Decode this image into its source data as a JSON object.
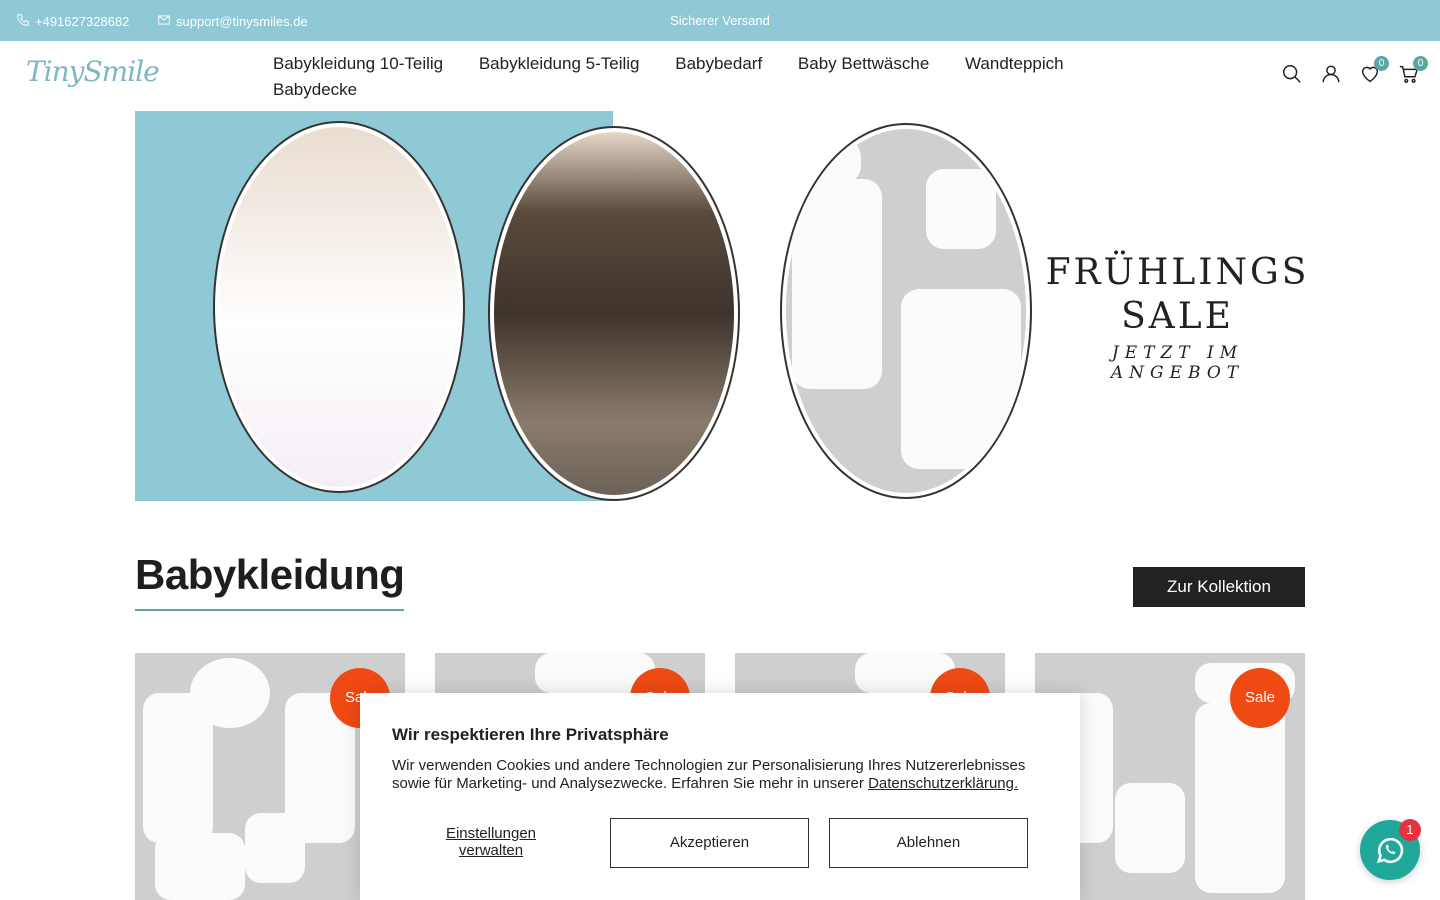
{
  "topbar": {
    "phone": "+491627328682",
    "email": "support@tinysmiles.de",
    "center_text": "Sicherer Versand",
    "phone_icon": "phone-icon",
    "mail_icon": "mail-icon"
  },
  "header": {
    "logo": "TinySmile",
    "nav": [
      "Babykleidung 10-Teilig",
      "Babykleidung 5-Teilig",
      "Babybedarf",
      "Baby Bettwäsche",
      "Wandteppich",
      "Babydecke"
    ],
    "wishlist_count": "0",
    "cart_count": "0",
    "icons": [
      "search-icon",
      "account-icon",
      "heart-icon",
      "cart-icon"
    ]
  },
  "hero": {
    "line1": "FRÜHLINGS",
    "line2": "SALE",
    "line3": "JETZT IM ANGEBOT"
  },
  "section": {
    "title": "Babykleidung",
    "collection_button": "Zur Kollektion"
  },
  "products": [
    {
      "sale": "Sale"
    },
    {
      "sale": "Sale"
    },
    {
      "sale": "Sale"
    },
    {
      "sale": "Sale"
    }
  ],
  "cookie": {
    "title": "Wir respektieren Ihre Privatsphäre",
    "text": "Wir verwenden Cookies und andere Technologien zur Personalisierung Ihres Nutzererlebnisses sowie für Marketing- und Analysezwecke. Erfahren Sie mehr in unserer",
    "link": "Datenschutzerklärung.",
    "manage": "Einstellungen verwalten",
    "accept": "Akzeptieren",
    "decline": "Ablehnen"
  },
  "chat": {
    "count": "1",
    "icon": "whatsapp-icon"
  },
  "colors": {
    "topbar": "#8fc9d6",
    "accent": "#59a6a3",
    "sale": "#f04a14",
    "chat": "#1fa89a",
    "dark_button": "#222222"
  }
}
